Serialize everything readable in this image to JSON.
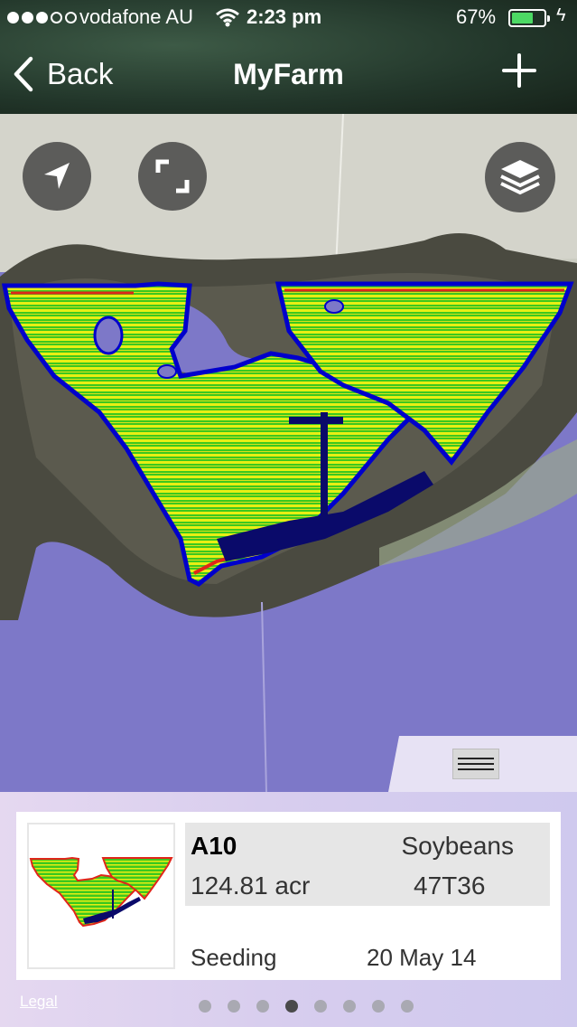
{
  "status_bar": {
    "carrier": "vodafone AU",
    "time": "2:23 pm",
    "battery_percent": "67%",
    "battery_level": 0.67,
    "signal_bars_filled": 3,
    "signal_bars_total": 5
  },
  "nav": {
    "back_label": "Back",
    "title": "MyFarm"
  },
  "map_controls": {
    "locate_icon": "location-arrow-icon",
    "fullscreen_icon": "fullscreen-icon",
    "layers_icon": "layers-icon",
    "drawer_icon": "menu-lines-icon"
  },
  "field_card": {
    "name": "A10",
    "crop": "Soybeans",
    "area": "124.81 acr",
    "variety": "47T36",
    "operation": "Seeding",
    "date": "20 May 14"
  },
  "footer": {
    "legal_label": "Legal"
  },
  "pager": {
    "count": 8,
    "active_index": 3
  },
  "colors": {
    "accent_blue": "#0000cc",
    "yield_green": "#3cc81e",
    "yield_yellow": "#e8ee14",
    "yield_red": "#e0261a",
    "water_purple": "#7d78c8"
  }
}
